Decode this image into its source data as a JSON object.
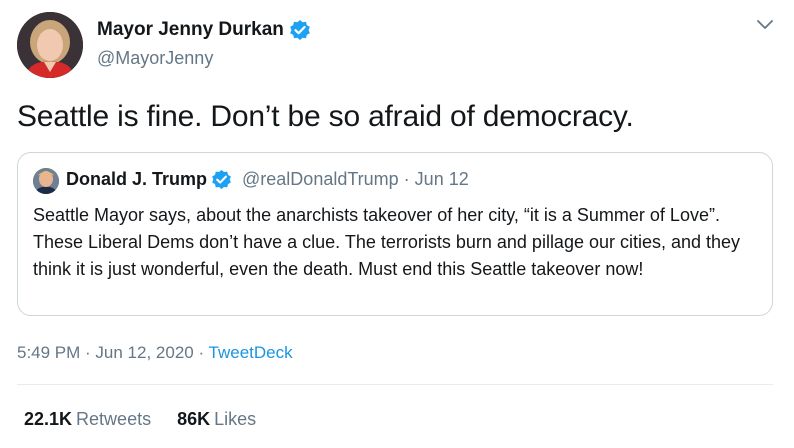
{
  "colors": {
    "text": "#14171a",
    "secondary": "#657786",
    "link": "#1b95e0",
    "verified": "#1da1f2",
    "border": "#ccd6dd"
  },
  "tweet": {
    "author_name": "Mayor Jenny Durkan",
    "author_handle": "@MayorJenny",
    "text": "Seattle is fine. Don’t be so afraid of democracy.",
    "time_date": "5:49 PM · Jun 12, 2020 · ",
    "source": "TweetDeck"
  },
  "quoted": {
    "name": "Donald J. Trump",
    "handle_date": "@realDonaldTrump · Jun 12",
    "text": "Seattle Mayor says, about the anarchists takeover of her city, “it is a Summer of Love”. These Liberal Dems don’t have a clue. The terrorists burn and pillage our cities, and they think it is just wonderful, even the death. Must end this Seattle takeover now!"
  },
  "stats": {
    "retweets_count": "22.1K",
    "retweets_label": "Retweets",
    "likes_count": "86K",
    "likes_label": "Likes"
  },
  "icons": [
    "verified-badge-icon",
    "chevron-down-icon"
  ]
}
